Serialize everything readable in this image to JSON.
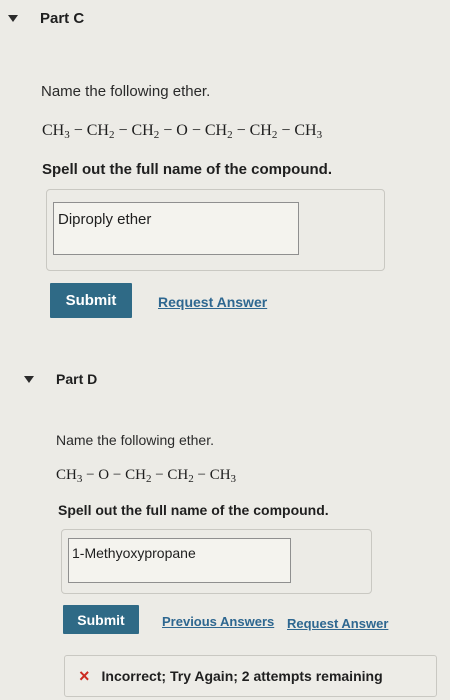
{
  "part_c": {
    "title": "Part C",
    "prompt": "Name the following ether.",
    "formula": {
      "p1": "CH",
      "s1": "3",
      "p2": " − CH",
      "s2": "2",
      "p3": " − CH",
      "s3": "2",
      "p4": " − O − CH",
      "s4": "2",
      "p5": " − CH",
      "s5": "2",
      "p6": " − CH",
      "s6": "3"
    },
    "instruction": "Spell out the full name of the compound.",
    "answer_value": "Diproply ether",
    "submit_label": "Submit",
    "request_answer_label": "Request Answer"
  },
  "part_d": {
    "title": "Part D",
    "prompt": "Name the following ether.",
    "formula": {
      "p1": "CH",
      "s1": "3",
      "p2": " − O − CH",
      "s2": "2",
      "p3": " − CH",
      "s3": "2",
      "p4": " − CH",
      "s4": "3"
    },
    "instruction": "Spell out the full name of the compound.",
    "answer_value": "1-Methyoxypropane",
    "submit_label": "Submit",
    "previous_answers_label": "Previous Answers",
    "request_answer_label": "Request Answer",
    "feedback_text": "Incorrect; Try Again; 2 attempts remaining",
    "feedback_icon": "×"
  },
  "colors": {
    "button": "#2f6a86",
    "link": "#2e6790",
    "error": "#cc2b21"
  }
}
